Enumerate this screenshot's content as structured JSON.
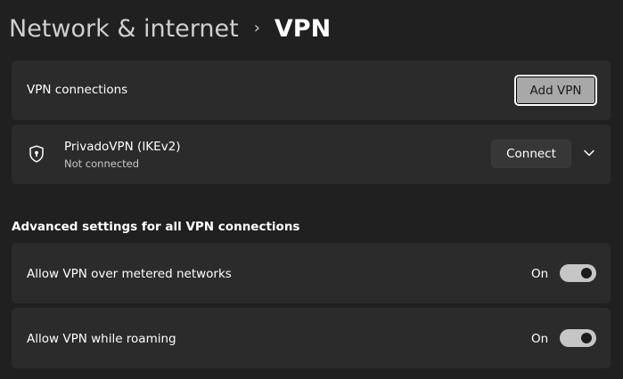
{
  "breadcrumb": {
    "parent": "Network & internet",
    "separator": "›",
    "current": "VPN"
  },
  "vpn_connections": {
    "label": "VPN connections",
    "add_button": "Add VPN"
  },
  "connection": {
    "name": "PrivadoVPN (IKEv2)",
    "status": "Not connected",
    "connect_button": "Connect",
    "icon": "shield-lock-icon",
    "expand_icon": "chevron-down-icon"
  },
  "advanced": {
    "heading": "Advanced settings for all VPN connections",
    "settings": [
      {
        "label": "Allow VPN over metered networks",
        "state": "On",
        "enabled": true
      },
      {
        "label": "Allow VPN while roaming",
        "state": "On",
        "enabled": true
      }
    ]
  },
  "colors": {
    "background": "#202020",
    "card": "#2b2b2b",
    "toggle_on": "#c6c6c6",
    "add_button_fill": "#a8a8a8"
  }
}
